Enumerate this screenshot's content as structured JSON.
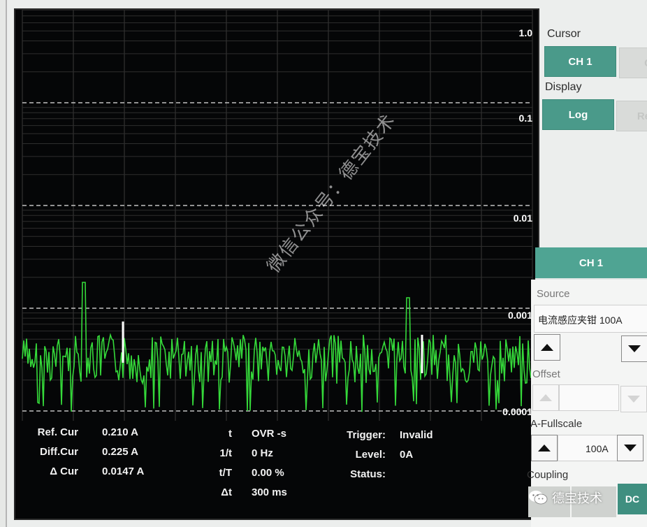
{
  "plot": {
    "y_scale_labels": [
      "1.0",
      "0.1",
      "0.01",
      "0.001",
      "0.0001"
    ],
    "y_scale": "log",
    "trace_color": "#35d93a",
    "marker_color": "#ffffff"
  },
  "readouts": {
    "ref_cur_label": "Ref. Cur",
    "ref_cur_value": "0.210 A",
    "diff_cur_label": "Diff.Cur",
    "diff_cur_value": "0.225 A",
    "delta_cur_label": "Δ Cur",
    "delta_cur_value": "0.0147 A",
    "t_label": "t",
    "t_value": "OVR -s",
    "inv_t_label": "1/t",
    "inv_t_value": "0 Hz",
    "t_over_T_label": "t/T",
    "t_over_T_value": "0.00 %",
    "delta_t_label": "Δt",
    "delta_t_value": "300 ms",
    "trigger_label": "Trigger:",
    "trigger_value": "Invalid",
    "level_label": "Level:",
    "level_value": "0A",
    "status_label": "Status:"
  },
  "panel": {
    "cursor_label": "Cursor",
    "cursor_ch1": "CH 1",
    "cursor_ch2_partial": "C",
    "display_label": "Display",
    "display_log": "Log",
    "display_other_partial": "Re",
    "channel_header": "CH 1",
    "source_label": "Source",
    "source_value": "电流感应夹钳 100A",
    "offset_label": "Offset",
    "fullscale_label": "A-Fullscale",
    "fullscale_value": "100A",
    "coupling_label": "Coupling",
    "coupling_dc": "DC"
  },
  "watermark": {
    "diagonal_text": "微信公众号：德宝技术",
    "brand_text": "德宝技术"
  },
  "colors": {
    "accent": "#4a9a8a",
    "scope_bg": "#050607"
  }
}
